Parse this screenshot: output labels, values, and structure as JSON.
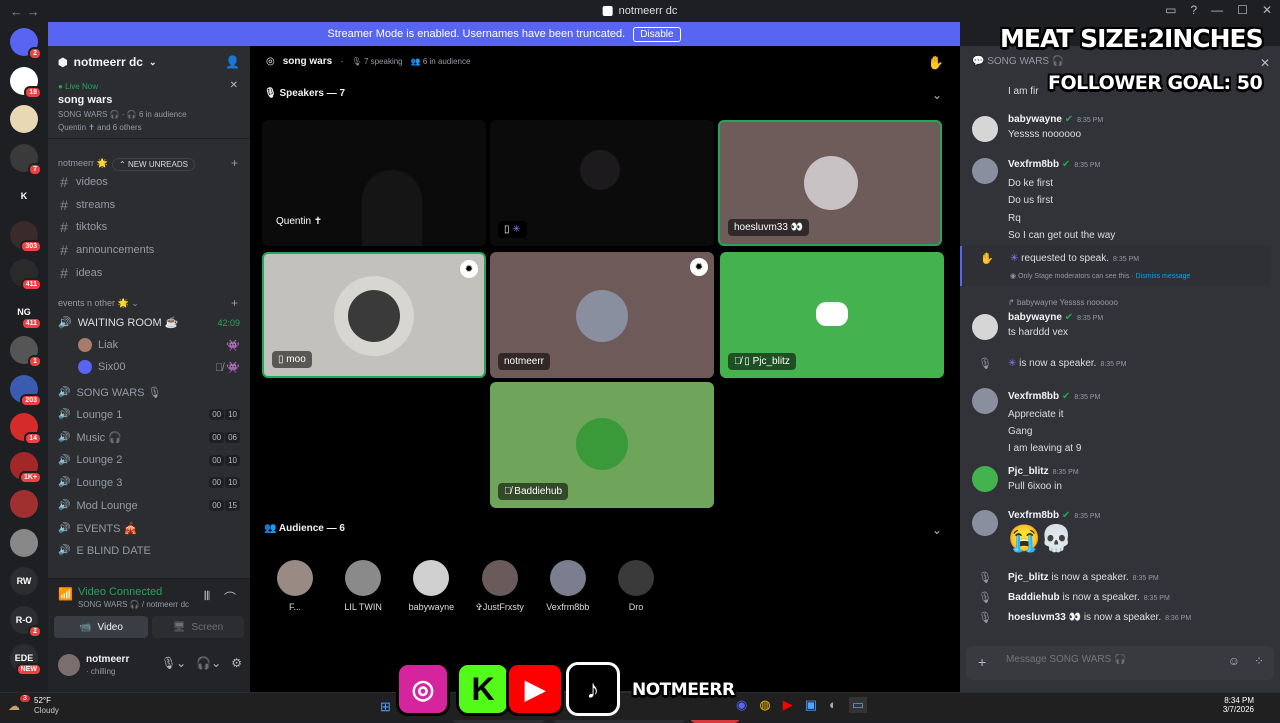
{
  "window": {
    "title": "notmeerr dc",
    "back": "←",
    "forward": "→"
  },
  "banner": {
    "text": "Streamer Mode is enabled. Usernames have been truncated.",
    "button": "Disable"
  },
  "servers": [
    {
      "label": "",
      "badge": "2",
      "color": "#5865f2"
    },
    {
      "label": "",
      "badge": "18",
      "color": "#ffffff"
    },
    {
      "label": "",
      "badge": "",
      "color": "#e9d8b4"
    },
    {
      "label": "",
      "badge": "7",
      "color": "#3a3a3a"
    },
    {
      "label": "K",
      "badge": "",
      "color": "#1e1f22"
    },
    {
      "label": "",
      "badge": "303",
      "color": "#3a2a2a"
    },
    {
      "label": "",
      "badge": "411",
      "color": "#2a2a2a"
    },
    {
      "label": "NG",
      "badge": "411",
      "color": "#1e1f22"
    },
    {
      "label": "",
      "badge": "1",
      "color": "#555555"
    },
    {
      "label": "",
      "badge": "203",
      "color": "#3a5bb0"
    },
    {
      "label": "",
      "badge": "14",
      "color": "#d62b2b"
    },
    {
      "label": "",
      "badge": "1K+",
      "color": "#a22828"
    },
    {
      "label": "",
      "badge": "",
      "color": "#a03030"
    },
    {
      "label": "",
      "badge": "",
      "color": "#888888"
    },
    {
      "label": "RW",
      "badge": "",
      "color": "#2b2d31"
    },
    {
      "label": "R-O",
      "badge": "2",
      "color": "#2b2d31"
    },
    {
      "label": "EDE",
      "badge": "NEW",
      "color": "#2b2d31"
    }
  ],
  "sidebar": {
    "guild_name": "notmeerr dc",
    "live": {
      "status": "Live Now",
      "stage": "song wars",
      "sub": "SONG WARS 🎧 · 🎧 6 in audience",
      "people": "Quentin ✝ and 6 others"
    },
    "cat1": "notmeerr 🌟",
    "new_unreads": "NEW UNREADS",
    "channels": [
      "videos",
      "streams",
      "tiktoks",
      "announcements",
      "ideas"
    ],
    "cat2": "events n other 🌟",
    "waiting_room": {
      "name": "WAITING ROOM ☕",
      "time": "42:09",
      "members": [
        "Liak",
        "Six00"
      ]
    },
    "voice": [
      {
        "name": "SONG WARS 🎙",
        "a": "",
        "b": ""
      },
      {
        "name": "Lounge 1",
        "a": "00",
        "b": "10"
      },
      {
        "name": "Music 🎧",
        "a": "00",
        "b": "06"
      },
      {
        "name": "Lounge 2",
        "a": "00",
        "b": "10"
      },
      {
        "name": "Lounge 3",
        "a": "00",
        "b": "10"
      },
      {
        "name": "Mod Lounge",
        "a": "00",
        "b": "15"
      },
      {
        "name": "EVENTS 🎪",
        "a": "",
        "b": ""
      },
      {
        "name": "E BLIND DATE",
        "a": "",
        "b": ""
      }
    ],
    "voice_connected": {
      "status": "Video Connected",
      "location": "SONG WARS 🎧 / notmeerr dc",
      "video": "Video",
      "screen": "Screen"
    },
    "user": {
      "name": "notmeerr",
      "status": "· chilling"
    }
  },
  "stage": {
    "name": "song wars",
    "speaking": "7 speaking",
    "audience_count": "6 in audience",
    "speakers_header": "Speakers — 7",
    "audience_header": "Audience — 6",
    "tiles": [
      "Quentin ✝",
      "",
      "hoesluvm33 👀",
      "moo",
      "notmeerr",
      "Pjc_blitz",
      "Baddiehub"
    ],
    "audience": [
      "F...",
      "LIL TWIN",
      "babywayne",
      "✞JustFrxsty",
      "Vexfrm8bb",
      "Dro"
    ]
  },
  "chat": {
    "channel": "SONG WARS 🎧",
    "messages": [
      {
        "user": "",
        "time": "",
        "lines": [
          "I am fir"
        ]
      },
      {
        "user": "babywayne",
        "time": "8:35 PM",
        "lines": [
          "Yessss noooooo"
        ]
      },
      {
        "user": "Vexfrm8bb",
        "time": "8:35 PM",
        "lines": [
          "Do ke first",
          "Do us first",
          "Rq",
          "So I can get out the way"
        ]
      },
      {
        "user": "babywayne",
        "time": "8:35 PM",
        "lines": [
          "ts harddd vex"
        ]
      },
      {
        "user": "Vexfrm8bb",
        "time": "8:35 PM",
        "lines": [
          "Appreciate it",
          "Gang",
          "I am leaving at 9"
        ]
      },
      {
        "user": "Pjc_blitz",
        "time": "8:35 PM",
        "lines": [
          "Pull 6ixoo in"
        ]
      },
      {
        "user": "Vexfrm8bb",
        "time": "8:35 PM",
        "lines": [
          "😭💀"
        ]
      }
    ],
    "request": {
      "text": "requested to speak.",
      "time": "8:35 PM",
      "note": "Only Stage moderators can see this ·",
      "dismiss": "Dismiss message"
    },
    "reply": "babywayne Yessss noooooo",
    "now_speaker": {
      "text": "is now a speaker.",
      "time": "8:35 PM"
    },
    "system": [
      {
        "user": "Pjc_blitz",
        "text": "is now a speaker.",
        "time": "8:35 PM"
      },
      {
        "user": "Baddiehub",
        "text": "is now a speaker.",
        "time": "8:35 PM"
      },
      {
        "user": "hoesluvm33 👀",
        "text": "is now a speaker.",
        "time": "8:36 PM"
      }
    ],
    "input_placeholder": "Message SONG WARS 🎧"
  },
  "overlay": {
    "line1": "MEAT SIZE:2INCHES",
    "line2": "FOLLOWER GOAL: 50",
    "handle": "NOTMEERR"
  },
  "taskbar": {
    "temp": "52°F",
    "weather": "Cloudy",
    "weather_badge": "3",
    "time": "8:34 PM",
    "date": "3/7/2026"
  },
  "colors": {
    "accent": "#5865f2",
    "green": "#23a55a",
    "red": "#da373c",
    "tile_green": "#43b24f"
  }
}
